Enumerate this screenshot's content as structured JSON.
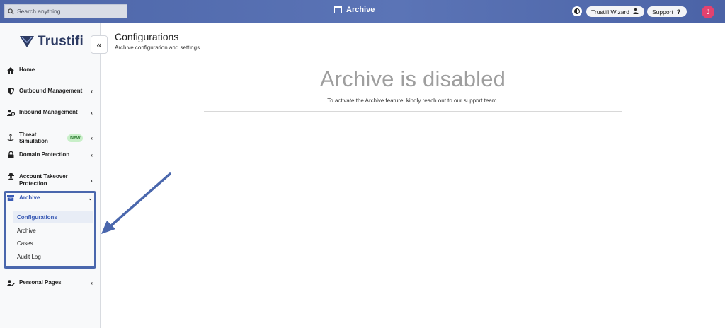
{
  "topbar": {
    "search_placeholder": "Search anything...",
    "title": "Archive",
    "wizard_label": "Trustifi Wizard",
    "support_label": "Support",
    "avatar_initial": "J"
  },
  "sidebar": {
    "brand": "Trustifi",
    "collapse_icon": "double-chevron-left-icon",
    "items": [
      {
        "label": "Home",
        "icon": "home-icon"
      },
      {
        "label": "Outbound Management",
        "icon": "shield-icon"
      },
      {
        "label": "Inbound Management",
        "icon": "users-cog-icon"
      },
      {
        "label": "Threat Simulation",
        "icon": "anchor-icon",
        "badge": "New"
      },
      {
        "label": "Domain Protection",
        "icon": "lock-icon"
      },
      {
        "label": "Account Takeover Protection",
        "icon": "user-secret-icon"
      },
      {
        "label": "Archive",
        "icon": "archive-icon"
      },
      {
        "label": "Personal Pages",
        "icon": "user-edit-icon"
      }
    ],
    "archive_sub": [
      {
        "label": "Configurations"
      },
      {
        "label": "Archive"
      },
      {
        "label": "Cases"
      },
      {
        "label": "Audit Log"
      }
    ]
  },
  "main": {
    "title": "Configurations",
    "subtitle": "Archive configuration and settings",
    "disabled_title": "Archive is disabled",
    "disabled_text": "To activate the Archive feature, kindly reach out to our support team."
  },
  "colors": {
    "topbar": "#5066a8",
    "accent": "#3a5bb5",
    "badge_bg": "#c8efc8",
    "avatar": "#e2426f",
    "annotation": "#4a67ad"
  }
}
